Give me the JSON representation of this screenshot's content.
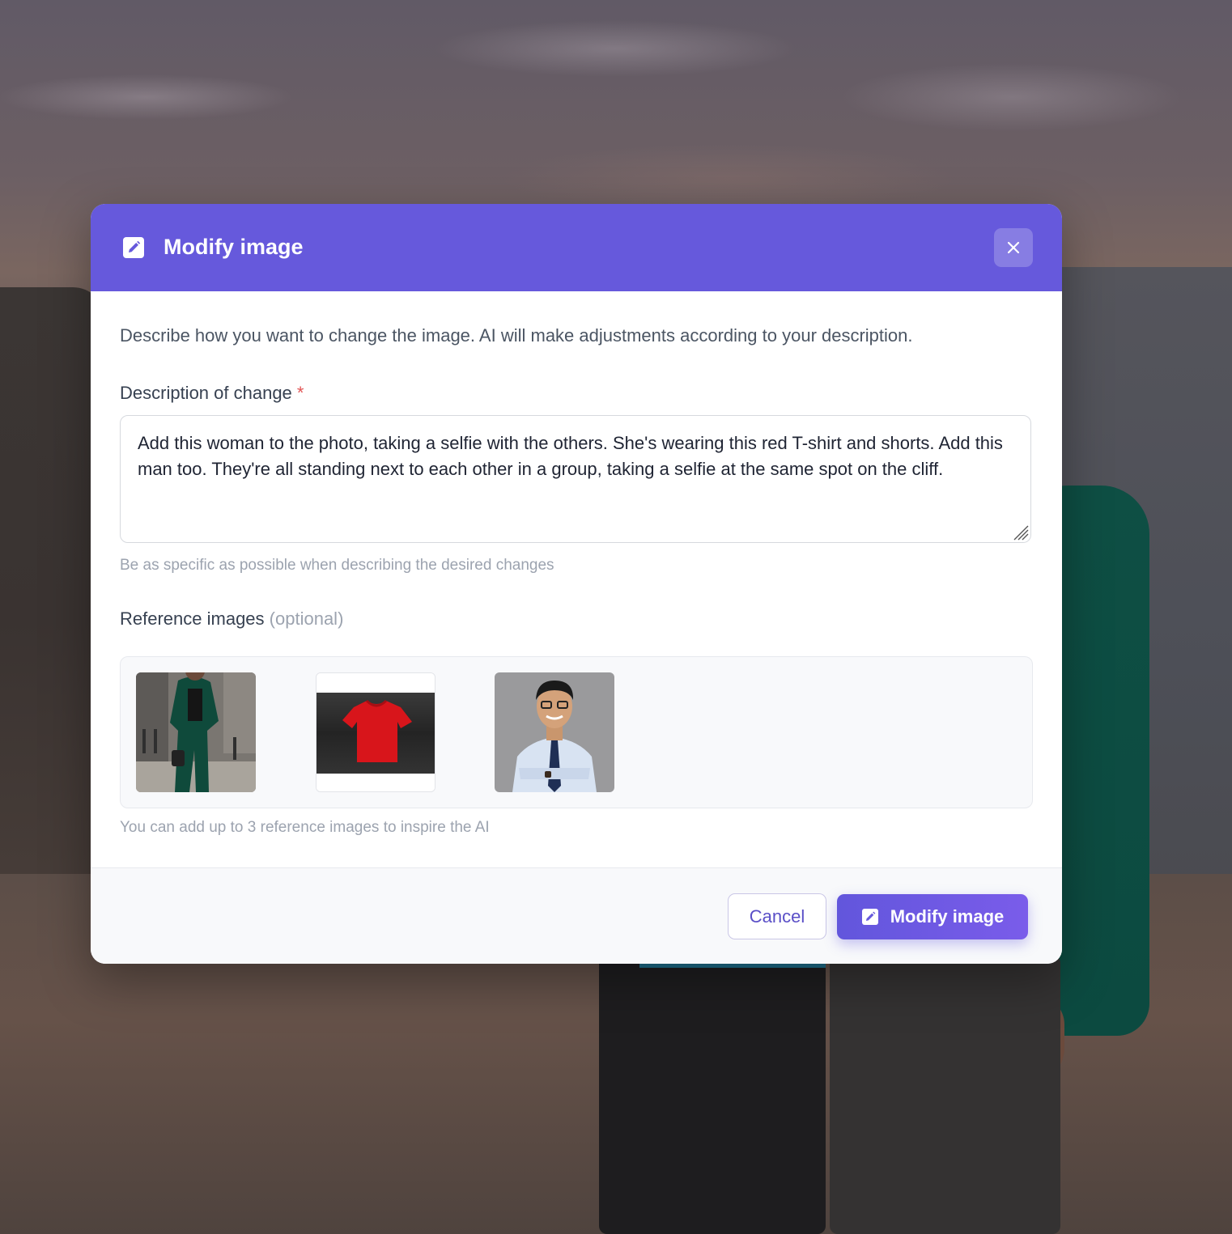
{
  "modal": {
    "title": "Modify image",
    "close_icon": "close-icon",
    "header_icon": "edit-icon",
    "intro": "Describe how you want to change the image. AI will make adjustments according to your description."
  },
  "description": {
    "label": "Description of change",
    "required_mark": "*",
    "value": "Add this woman to the photo, taking a selfie with the others. She's wearing this red T-shirt and shorts. Add this man too. They're all standing next to each other in a group, taking a selfie at the same spot on the cliff.",
    "hint": "Be as specific as possible when describing the desired changes"
  },
  "references": {
    "label": "Reference images",
    "optional": "(optional)",
    "hint": "You can add up to 3 reference images to inspire the AI",
    "images": [
      {
        "subject": "woman-in-green-suit"
      },
      {
        "subject": "red-t-shirt"
      },
      {
        "subject": "man-in-shirt-and-tie"
      }
    ]
  },
  "footer": {
    "cancel_label": "Cancel",
    "submit_label": "Modify image",
    "submit_icon": "edit-icon"
  },
  "colors": {
    "accent": "#6659dc",
    "required": "#e25555"
  }
}
